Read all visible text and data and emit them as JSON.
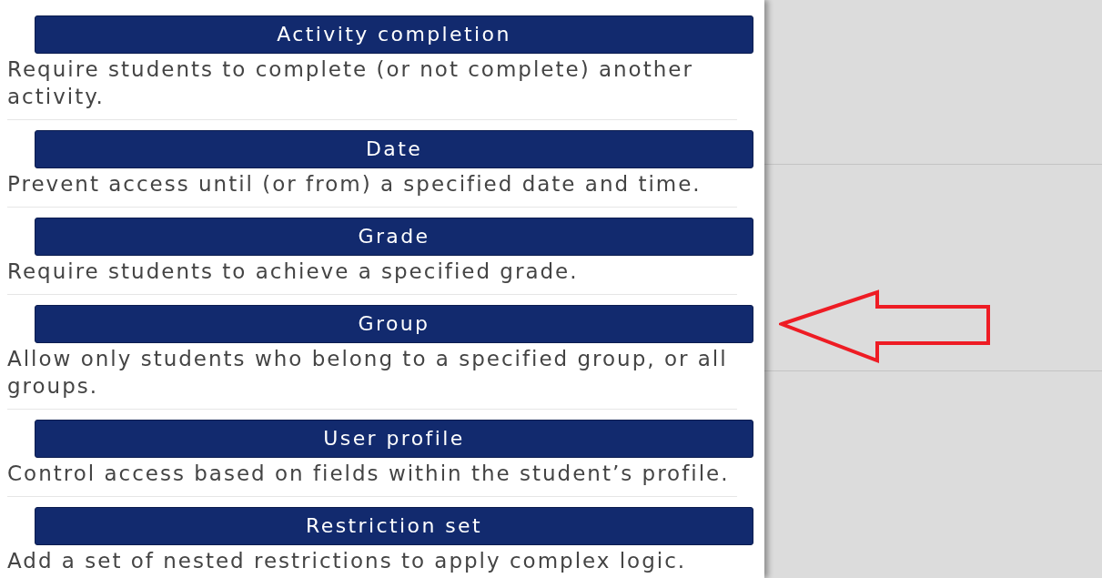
{
  "options": [
    {
      "button": "Activity completion",
      "description": "Require students to complete (or not complete) another activity.",
      "pointed": false
    },
    {
      "button": "Date",
      "description": "Prevent access until (or from) a specified date and time.",
      "pointed": false
    },
    {
      "button": "Grade",
      "description": "Require students to achieve a specified grade.",
      "pointed": false
    },
    {
      "button": "Group",
      "description": "Allow only students who belong to a specified group, or all groups.",
      "pointed": true
    },
    {
      "button": "User profile",
      "description": "Control access based on fields within the student’s profile.",
      "pointed": false
    },
    {
      "button": "Restriction set",
      "description": "Add a set of nested restrictions to apply complex logic.",
      "pointed": false
    }
  ]
}
